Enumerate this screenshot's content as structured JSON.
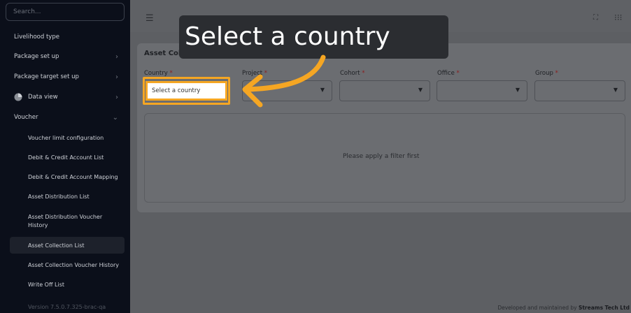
{
  "sidebar": {
    "search_placeholder": "Search...",
    "items": [
      {
        "label": "Livelihood type",
        "has_chevron": false
      },
      {
        "label": "Package set up",
        "has_chevron": true
      },
      {
        "label": "Package target set up",
        "has_chevron": true
      },
      {
        "label": "Data view",
        "has_chevron": true,
        "icon": "pie-chart-icon"
      },
      {
        "label": "Voucher",
        "has_chevron": true,
        "expanded": true
      }
    ],
    "voucher_children": [
      "Voucher limit configuration",
      "Debit & Credit Account List",
      "Debit & Credit Account Mapping",
      "Asset Distribution List",
      "Asset Distribution Voucher History",
      "Asset Collection List",
      "Asset Collection Voucher History",
      "Write Off List"
    ],
    "active_child": "Asset Collection List",
    "version": "Version 7.5.0.7.325-brac-qa"
  },
  "page": {
    "title": "Asset Collection List",
    "filters": [
      {
        "label": "Country",
        "placeholder": "Select a country"
      },
      {
        "label": "Project",
        "placeholder": ""
      },
      {
        "label": "Cohort",
        "placeholder": ""
      },
      {
        "label": "Office",
        "placeholder": ""
      },
      {
        "label": "Group",
        "placeholder": ""
      }
    ],
    "required_mark": "*",
    "empty_message": "Please apply a filter first"
  },
  "footer": {
    "prefix": "Developed and maintained by",
    "company": "Streams Tech Ltd"
  },
  "overlay": {
    "tooltip_text": "Select a country",
    "highlight_color": "#f5a623"
  },
  "colors": {
    "sidebar_bg": "#0b0f1a",
    "overlay_dim": "#5d5f63",
    "tooltip_bg": "#2b2d31",
    "accent": "#f5a623"
  }
}
